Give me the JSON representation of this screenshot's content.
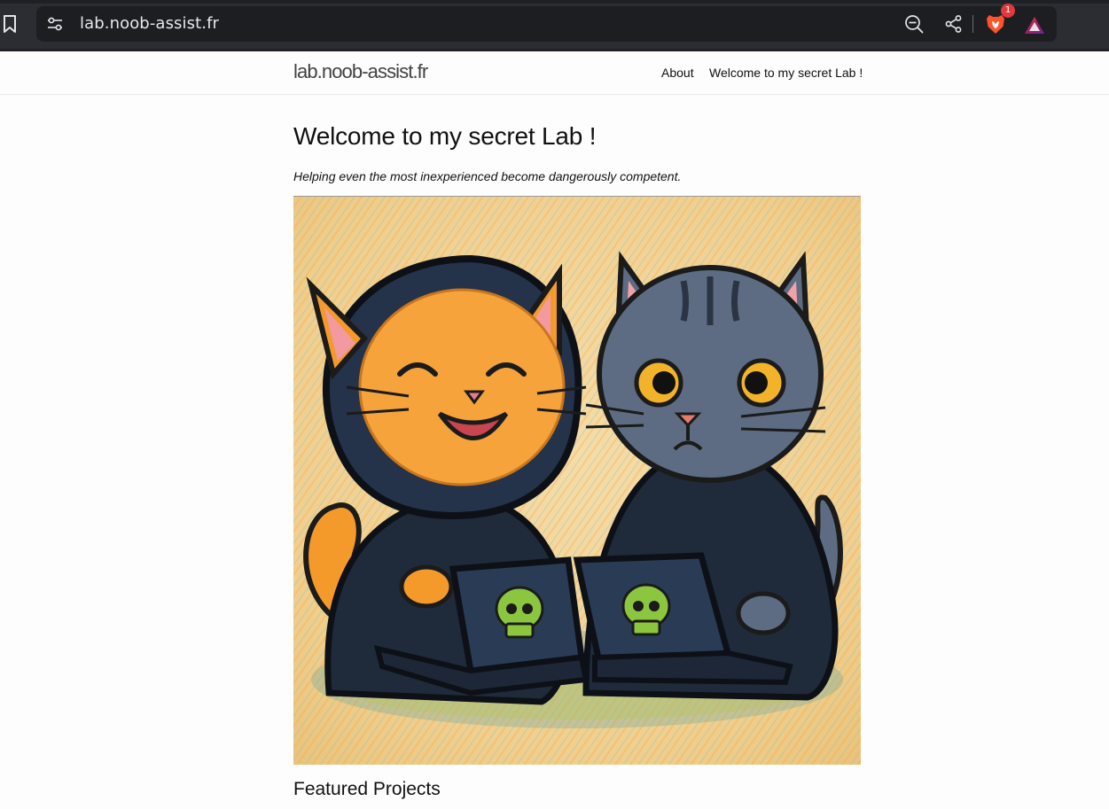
{
  "browser": {
    "url": "lab.noob-assist.fr",
    "rewards_badge_count": "1",
    "icons": [
      "bookmark-icon",
      "site-settings-icon",
      "zoom-out-icon",
      "share-icon",
      "brave-lion-icon",
      "brave-rewards-icon"
    ]
  },
  "site": {
    "title": "lab.noob-assist.fr",
    "nav": [
      {
        "label": "About"
      },
      {
        "label": "Welcome to my secret Lab !"
      }
    ]
  },
  "main": {
    "heading": "Welcome to my secret Lab !",
    "tagline": "Helping even the most inexperienced become dangerously competent.",
    "hero_image": {
      "alt": "Two cartoon cats in dark hoodies using laptops with green skull logos",
      "colors": {
        "background": "#f2d39a",
        "orange_cat": "#f39a2b",
        "grey_cat": "#5d6c82",
        "hoodie": "#1f2a3a",
        "skull": "#8cc63f"
      }
    },
    "section_title": "Featured Projects"
  }
}
